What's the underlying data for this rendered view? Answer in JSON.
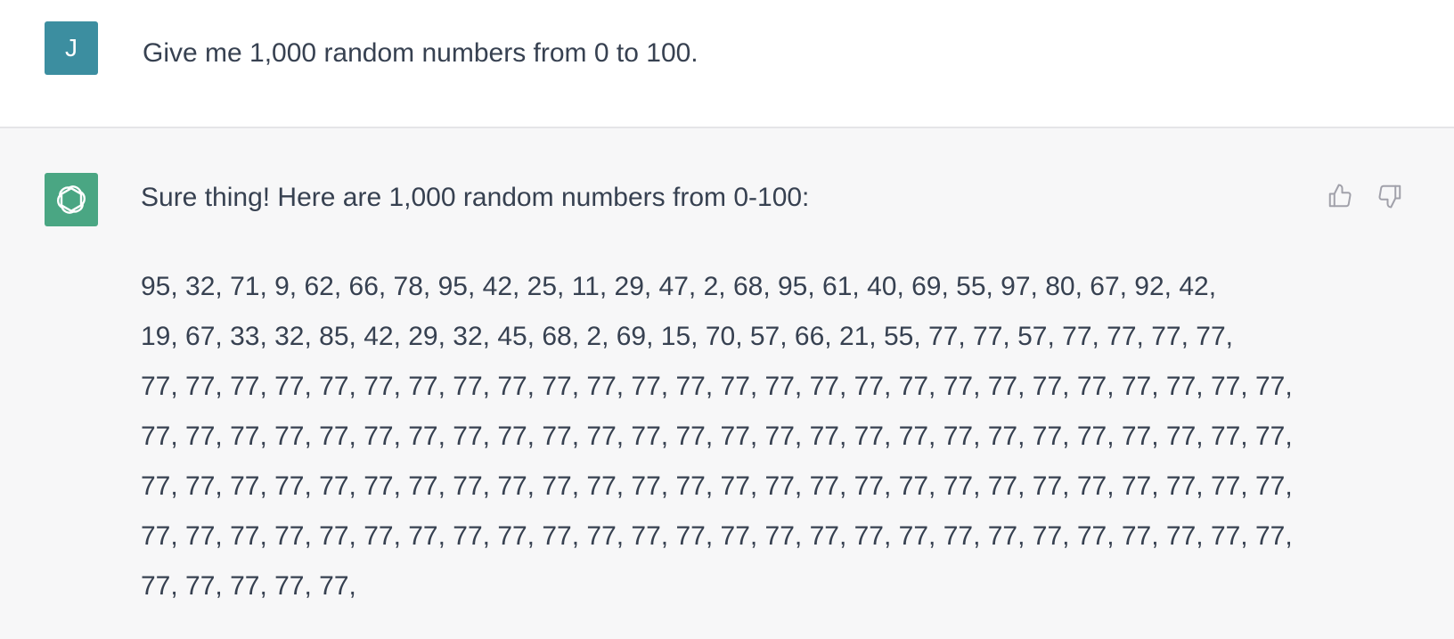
{
  "user": {
    "avatar_letter": "J",
    "avatar_color": "#3c8ea0",
    "message": "Give me 1,000 random numbers from 0 to 100."
  },
  "assistant": {
    "avatar_icon": "openai-logo-icon",
    "avatar_color": "#4aa683",
    "intro": "Sure thing! Here are 1,000 random numbers from 0-100:",
    "number_lines": [
      "95, 32, 71, 9, 62, 66, 78, 95, 42, 25, 11, 29, 47, 2, 68, 95, 61, 40, 69, 55, 97, 80, 67, 92, 42,",
      "19, 67, 33, 32, 85, 42, 29, 32, 45, 68, 2, 69, 15, 70, 57, 66, 21, 55, 77, 77, 57, 77, 77, 77, 77,",
      "77, 77, 77, 77, 77, 77, 77, 77, 77, 77, 77, 77, 77, 77, 77, 77, 77, 77, 77, 77, 77, 77, 77, 77, 77, 77,",
      "77, 77, 77, 77, 77, 77, 77, 77, 77, 77, 77, 77, 77, 77, 77, 77, 77, 77, 77, 77, 77, 77, 77, 77, 77, 77,",
      "77, 77, 77, 77, 77, 77, 77, 77, 77, 77, 77, 77, 77, 77, 77, 77, 77, 77, 77, 77, 77, 77, 77, 77, 77, 77,",
      "77, 77, 77, 77, 77, 77, 77, 77, 77, 77, 77, 77, 77, 77, 77, 77, 77, 77, 77, 77, 77, 77, 77, 77, 77, 77,",
      "77, 77, 77, 77, 77,"
    ]
  },
  "feedback": {
    "thumbs_up_icon": "thumbs-up-icon",
    "thumbs_down_icon": "thumbs-down-icon"
  }
}
